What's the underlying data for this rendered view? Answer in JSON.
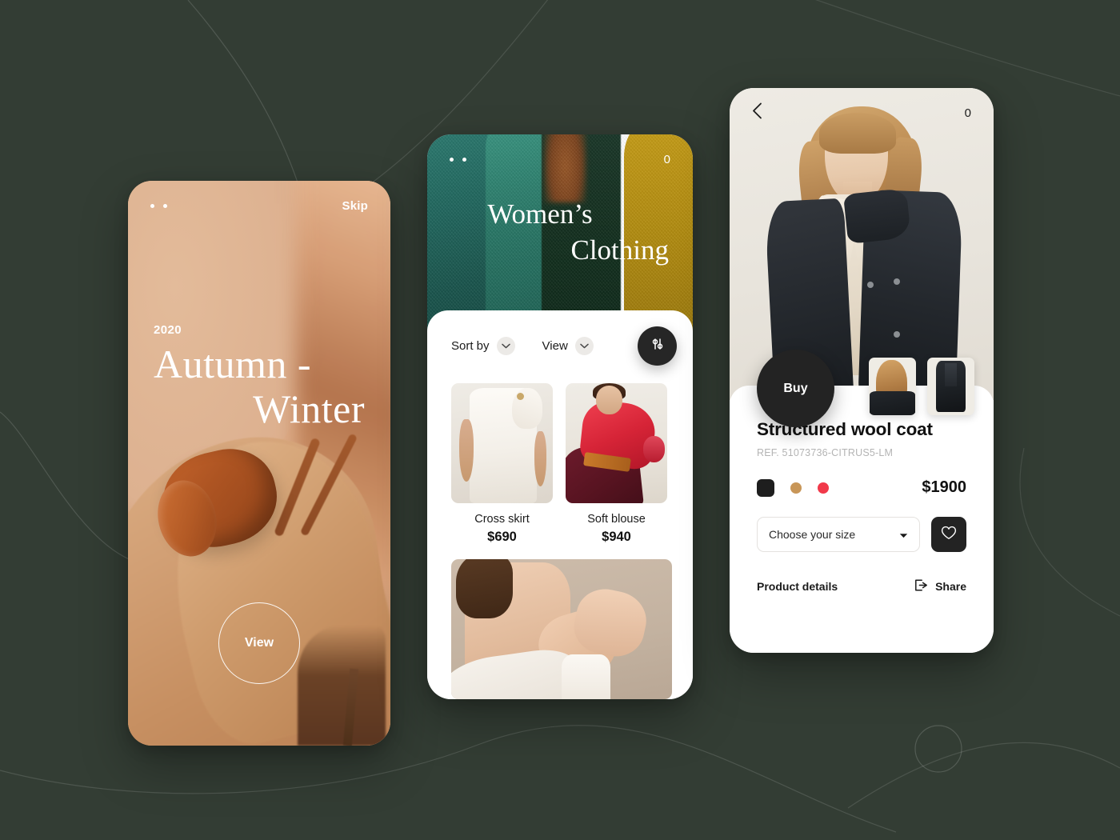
{
  "background": {
    "color": "#333d34",
    "decor_line_color": "rgba(255,255,255,0.16)"
  },
  "screens": [
    {
      "id": "onboarding",
      "name": "Autumn Winter onboarding",
      "topbar": {
        "pagination_dots": 2,
        "skip_label": "Skip"
      },
      "year": "2020",
      "title_line1": "Autumn -",
      "title_line2": "Winter",
      "view_button_label": "View"
    },
    {
      "id": "catalog",
      "name": "Women's Clothing catalog",
      "topbar": {
        "pagination_dots": 2,
        "cart_count": "0"
      },
      "hero_title_line1": "Women’s",
      "hero_title_line2": "Clothing",
      "toolbar": {
        "sort_label": "Sort by",
        "view_label": "View",
        "filter_icon": "sliders-icon"
      },
      "products": [
        {
          "name": "Cross skirt",
          "price": "$690"
        },
        {
          "name": "Soft blouse",
          "price": "$940"
        }
      ]
    },
    {
      "id": "product-detail",
      "name": "Structured wool coat detail",
      "topbar": {
        "back_icon": "chevron-left-icon",
        "cart_count": "0"
      },
      "buy_label": "Buy",
      "title": "Structured wool coat",
      "ref": "REF. 51073736-CITRUS5-LM",
      "price": "$1900",
      "colors": [
        {
          "name": "black",
          "hex": "#1e1e1e",
          "selected": true
        },
        {
          "name": "tan",
          "hex": "#c89658",
          "selected": false
        },
        {
          "name": "red",
          "hex": "#f1394a",
          "selected": false
        }
      ],
      "size_select_value": "Choose your size",
      "favorite_icon": "heart-icon",
      "product_details_label": "Product details",
      "share_label": "Share",
      "share_icon": "share-arrow-icon",
      "thumbnails": 2
    }
  ]
}
